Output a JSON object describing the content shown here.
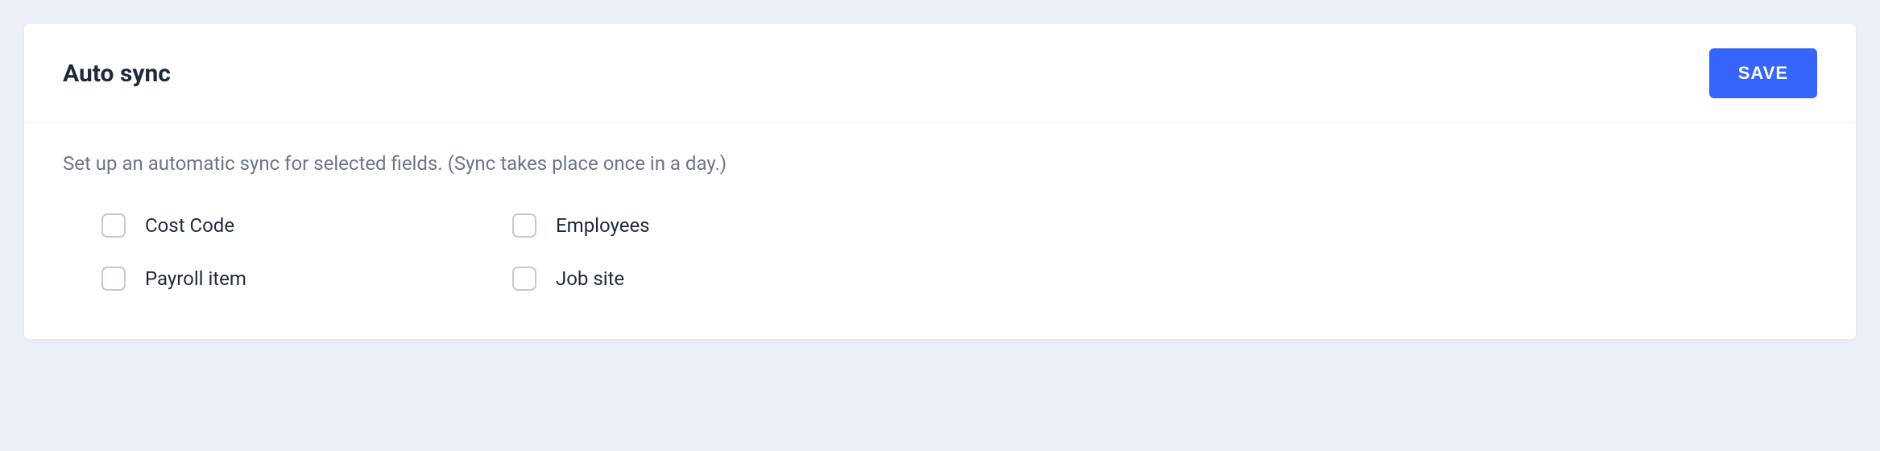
{
  "header": {
    "title": "Auto sync",
    "save_label": "SAVE"
  },
  "body": {
    "description": "Set up an automatic sync for selected fields. (Sync takes place once in a day.)",
    "options": [
      {
        "label": "Cost Code",
        "checked": false
      },
      {
        "label": "Employees",
        "checked": false
      },
      {
        "label": "Payroll item",
        "checked": false
      },
      {
        "label": "Job site",
        "checked": false
      }
    ]
  }
}
